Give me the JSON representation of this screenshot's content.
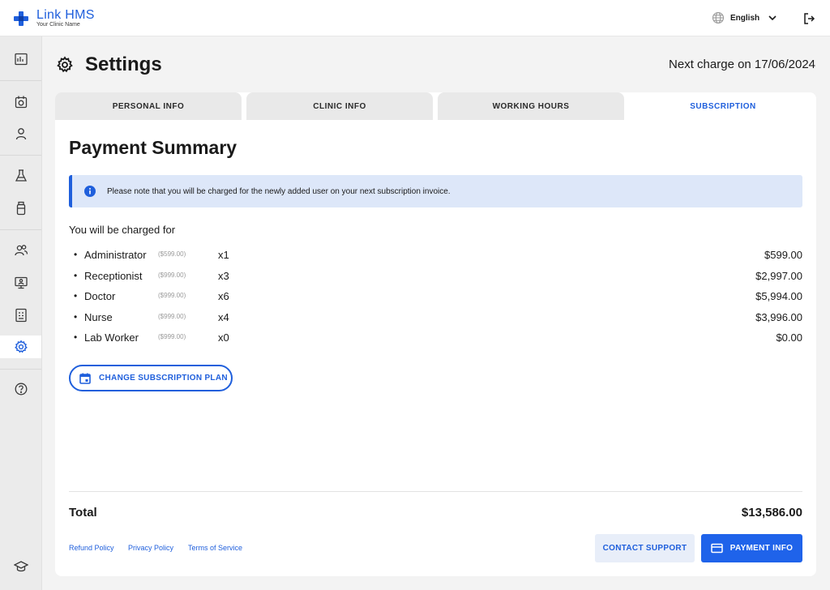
{
  "app": {
    "name": "Link HMS",
    "tagline": "Your Clinic Name",
    "brand_color": "#1f5fdc"
  },
  "topbar": {
    "language": "English",
    "icons": [
      "globe-icon",
      "chevron-down-icon",
      "logout-icon"
    ]
  },
  "sidebar": {
    "items": [
      {
        "icon": "dashboard-icon",
        "active": false
      },
      {
        "icon": "calendar-icon",
        "active": false
      },
      {
        "icon": "patient-icon",
        "active": false
      },
      {
        "icon": "lab-flask-icon",
        "active": false
      },
      {
        "icon": "medicine-bottle-icon",
        "active": false
      },
      {
        "icon": "staff-icon",
        "active": false
      },
      {
        "icon": "monitor-user-icon",
        "active": false
      },
      {
        "icon": "report-icon",
        "active": false
      },
      {
        "icon": "settings-icon",
        "active": true
      },
      {
        "icon": "help-icon",
        "active": false
      },
      {
        "icon": "graduation-cap-icon",
        "active": false
      }
    ]
  },
  "header": {
    "title": "Settings",
    "next_charge": "Next charge on 17/06/2024"
  },
  "tabs": [
    {
      "label": "PERSONAL INFO",
      "active": false
    },
    {
      "label": "CLINIC INFO",
      "active": false
    },
    {
      "label": "WORKING HOURS",
      "active": false
    },
    {
      "label": "SUBSCRIPTION",
      "active": true
    }
  ],
  "payment": {
    "title": "Payment Summary",
    "notice": "Please note that you will be charged for the newly added user on your next subscription invoice.",
    "charged_for_label": "You will be charged for",
    "items": [
      {
        "role": "Administrator",
        "unit_price": "($599.00)",
        "qty": "x1",
        "amount": "$599.00"
      },
      {
        "role": "Receptionist",
        "unit_price": "($999.00)",
        "qty": "x3",
        "amount": "$2,997.00"
      },
      {
        "role": "Doctor",
        "unit_price": "($999.00)",
        "qty": "x6",
        "amount": "$5,994.00"
      },
      {
        "role": "Nurse",
        "unit_price": "($999.00)",
        "qty": "x4",
        "amount": "$3,996.00"
      },
      {
        "role": "Lab Worker",
        "unit_price": "($999.00)",
        "qty": "x0",
        "amount": "$0.00"
      }
    ],
    "change_plan_label": "CHANGE SUBSCRIPTION PLAN",
    "total_label": "Total",
    "total_value": "$13,586.00"
  },
  "footer": {
    "links": [
      "Refund Policy",
      "Privacy Policy",
      "Terms of Service"
    ],
    "contact_support_label": "CONTACT SUPPORT",
    "payment_info_label": "PAYMENT INFO"
  }
}
